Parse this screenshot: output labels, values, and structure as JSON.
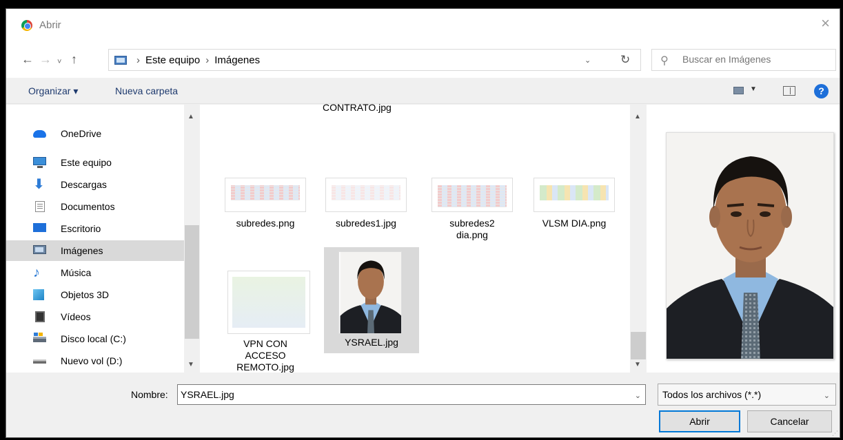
{
  "window": {
    "title": "Abrir",
    "close_glyph": "×",
    "icon": "chrome-icon"
  },
  "nav": {
    "back_glyph": "←",
    "forward_glyph": "→",
    "recent_glyph": "˅",
    "up_glyph": "↑",
    "breadcrumb": [
      "Este equipo",
      "Imágenes"
    ],
    "breadcrumb_sep": "›",
    "dropdown_glyph": "⌄",
    "refresh_glyph": "↻",
    "search_placeholder": "Buscar en Imágenes"
  },
  "toolbar": {
    "organize_label": "Organizar ▾",
    "new_folder_label": "Nueva carpeta",
    "view_dropdown_glyph": "▼",
    "help_glyph": "?"
  },
  "sidebar": {
    "items": [
      {
        "label": "OneDrive",
        "icon": "onedrive-cloud-icon"
      },
      {
        "label": "Este equipo",
        "icon": "computer-icon"
      },
      {
        "label": "Descargas",
        "icon": "download-arrow-icon"
      },
      {
        "label": "Documentos",
        "icon": "documents-icon"
      },
      {
        "label": "Escritorio",
        "icon": "desktop-icon"
      },
      {
        "label": "Imágenes",
        "icon": "pictures-icon",
        "selected": true
      },
      {
        "label": "Música",
        "icon": "music-note-icon"
      },
      {
        "label": "Objetos 3D",
        "icon": "3d-objects-icon"
      },
      {
        "label": "Vídeos",
        "icon": "videos-icon"
      },
      {
        "label": "Disco local (C:)",
        "icon": "local-disk-icon"
      },
      {
        "label": "Nuevo vol (D:)",
        "icon": "drive-icon"
      }
    ],
    "scroll_up_glyph": "▲",
    "scroll_down_glyph": "▼"
  },
  "files": {
    "partial_top_name": "CONTRATO.jpg",
    "items": [
      {
        "name_lines": [
          "subredes.png"
        ],
        "thumb": "table-thumbnail"
      },
      {
        "name_lines": [
          "subredes1.jpg"
        ],
        "thumb": "table-thumbnail"
      },
      {
        "name_lines": [
          "subredes2",
          "dia.png"
        ],
        "thumb": "table-thumbnail"
      },
      {
        "name_lines": [
          "VLSM DIA.png"
        ],
        "thumb": "diagram-thumbnail"
      },
      {
        "name_lines": [
          "VPN CON",
          "ACCESO",
          "REMOTO.jpg"
        ],
        "thumb": "network-diagram-thumbnail"
      },
      {
        "name_lines": [
          "YSRAEL.jpg"
        ],
        "thumb": "portrait-photo-thumbnail",
        "selected": true
      }
    ],
    "scroll_up_glyph": "▲",
    "scroll_down_glyph": "▼"
  },
  "preview": {
    "subject": "portrait-photo"
  },
  "footer": {
    "name_label": "Nombre:",
    "name_value": "YSRAEL.jpg",
    "dropdown_glyph": "⌄",
    "filter_value": "Todos los archivos (*.*)",
    "open_label": "Abrir",
    "cancel_label": "Cancelar",
    "grip_glyph": "⋰"
  },
  "colors": {
    "accent": "#0078d7",
    "selection": "#d9d9d9",
    "help_blue": "#1e6fd9",
    "suit": "#1d1f24",
    "shirt": "#8fb8e0"
  }
}
